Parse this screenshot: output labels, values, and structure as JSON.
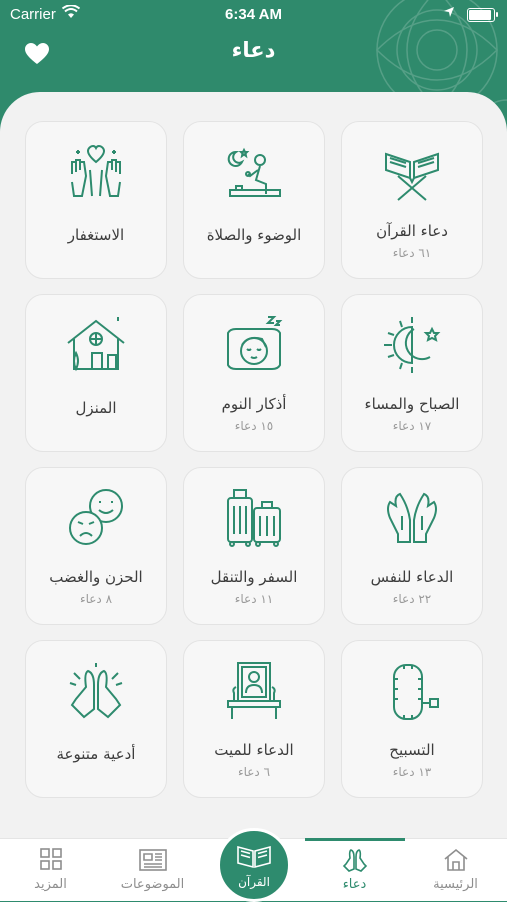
{
  "status_bar": {
    "carrier": "Carrier",
    "time": "6:34 AM"
  },
  "header": {
    "title": "دعاء"
  },
  "cards": [
    {
      "title": "دعاء القرآن",
      "count": "٦١ دعاء",
      "icon": "quran-stand-icon"
    },
    {
      "title": "الوضوء والصلاة",
      "count": "",
      "icon": "prayer-wudu-icon"
    },
    {
      "title": "الاستغفار",
      "count": "",
      "icon": "raised-hands-heart-icon"
    },
    {
      "title": "الصباح والمساء",
      "count": "١٧ دعاء",
      "icon": "sun-moon-icon"
    },
    {
      "title": "أذكار النوم",
      "count": "١٥ دعاء",
      "icon": "sleeping-face-icon"
    },
    {
      "title": "المنزل",
      "count": "",
      "icon": "house-icon"
    },
    {
      "title": "الدعاء للنفس",
      "count": "٢٢ دعاء",
      "icon": "dua-hands-icon"
    },
    {
      "title": "السفر والتنقل",
      "count": "١١ دعاء",
      "icon": "luggage-icon"
    },
    {
      "title": "الحزن والغضب",
      "count": "٨ دعاء",
      "icon": "sad-happy-faces-icon"
    },
    {
      "title": "التسبيح",
      "count": "١٣ دعاء",
      "icon": "prayer-beads-icon"
    },
    {
      "title": "الدعاء للميت",
      "count": "٦ دعاء",
      "icon": "memorial-portrait-icon"
    },
    {
      "title": "أدعية متنوعة",
      "count": "",
      "icon": "praying-hands-icon"
    }
  ],
  "tabbar": {
    "home": "الرئيسية",
    "dua": "دعاء",
    "quran": "القرآن",
    "topics": "الموضوعات",
    "more": "المزيد"
  },
  "colors": {
    "primary": "#2e8b6e",
    "background": "#f2f2f2",
    "card": "#f7f7f7"
  }
}
